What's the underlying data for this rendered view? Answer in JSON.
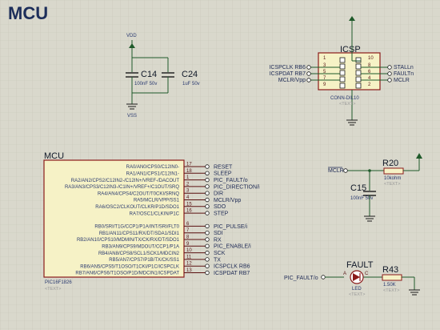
{
  "title": "MCU",
  "power": {
    "vdd": "VDD",
    "vss": "VSS",
    "c14": {
      "ref": "C14",
      "value": "100nF 50v"
    },
    "c24": {
      "ref": "C24",
      "value": "1uF 50v"
    }
  },
  "icsp": {
    "ref": "ICSP",
    "part": "CONN-DIL10",
    "text_hint": "<TEXT>",
    "left_labels": [
      "ICSPCLK RB6",
      "ICSPDAT RB7",
      "MCLR/Vpp"
    ],
    "right_labels": [
      "STALLn",
      "FAULTn",
      "MCLR"
    ],
    "pins_left": [
      "1",
      "3",
      "5",
      "7",
      "9"
    ],
    "pins_right": [
      "10",
      "8",
      "6",
      "4",
      "2"
    ]
  },
  "mcu": {
    "ref": "MCU",
    "part": "PIC16F1826",
    "text_hint": "<TEXT>",
    "pins": [
      {
        "name": "RA0/AN0/CPS0/C12IN0-",
        "num": "17",
        "net": "RESET"
      },
      {
        "name": "RA1/AN1/CPS1/C12IN1-",
        "num": "18",
        "net": "SLEEP"
      },
      {
        "name": "RA2/AN2/CPS2/C12IN2-/C12IN+/VREF-/DACOUT",
        "num": "1",
        "net": "PIC_FAULT/o"
      },
      {
        "name": "RA3/AN3/CPS3/C12IN3-/C1IN+/VREF+/C1OUT/SRQ",
        "num": "2",
        "net": "PIC_DIRECTION/i"
      },
      {
        "name": "RA4/AN4/CPS4/C2OUT/T0CKI/SRNQ",
        "num": "3",
        "net": "DIR"
      },
      {
        "name": "RA5/MCLR/VPP/SS1",
        "num": "4",
        "net": "MCLR/Vpp"
      },
      {
        "name": "RA6/OSC2/CLKOUT/CLKR/P1D/SDO1",
        "num": "15",
        "net": "SDO"
      },
      {
        "name": "RA7/OSC1/CLKIN/P1C",
        "num": "16",
        "net": "STEP"
      },
      {
        "name": "RB0/SRI/T1G/CCP1/P1A/INT/SRI/FLT0",
        "num": "6",
        "net": "PIC_PULSE/i"
      },
      {
        "name": "RB1/AN11/CPS11/RX/DT/SDA1/SDI1",
        "num": "7",
        "net": "SDI"
      },
      {
        "name": "RB2/AN10/CPS10/MDMIN/TX/CK/RX/DT/SDO1",
        "num": "8",
        "net": "RX"
      },
      {
        "name": "RB3/AN9/CPS9/MDOUT/CCP1/P1A",
        "num": "9",
        "net": "PIC_ENABLE/i"
      },
      {
        "name": "RB4/AN8/CPS8/SCL1/SCK1/MDCIN2",
        "num": "10",
        "net": "SCK"
      },
      {
        "name": "RB5/AN7/CPS7/P1B/TX/CK/SS1",
        "num": "11",
        "net": "TX"
      },
      {
        "name": "RB6/AN5/CPS5/T1OSO/T1CKI/P1C/ICSPCLK",
        "num": "12",
        "net": "ICSPCLK RB6"
      },
      {
        "name": "RB7/AN6/CPS6/T1OSO/P1D/MDCIN1/ICSPDAT",
        "num": "13",
        "net": "ICSPDAT RB7"
      }
    ]
  },
  "reset": {
    "mclr": "MCLR",
    "r20": {
      "ref": "R20",
      "value": "10kohm"
    },
    "c15": {
      "ref": "C15",
      "value": "100nF 50v"
    },
    "text_hint": "<TEXT>"
  },
  "fault": {
    "net": "PIC_FAULT/o",
    "led": {
      "ref": "FAULT",
      "part": "LED",
      "anode": "A",
      "cathode": "C"
    },
    "r43": {
      "ref": "R43",
      "value": "1.50K"
    },
    "text_hint": "<TEXT>"
  }
}
